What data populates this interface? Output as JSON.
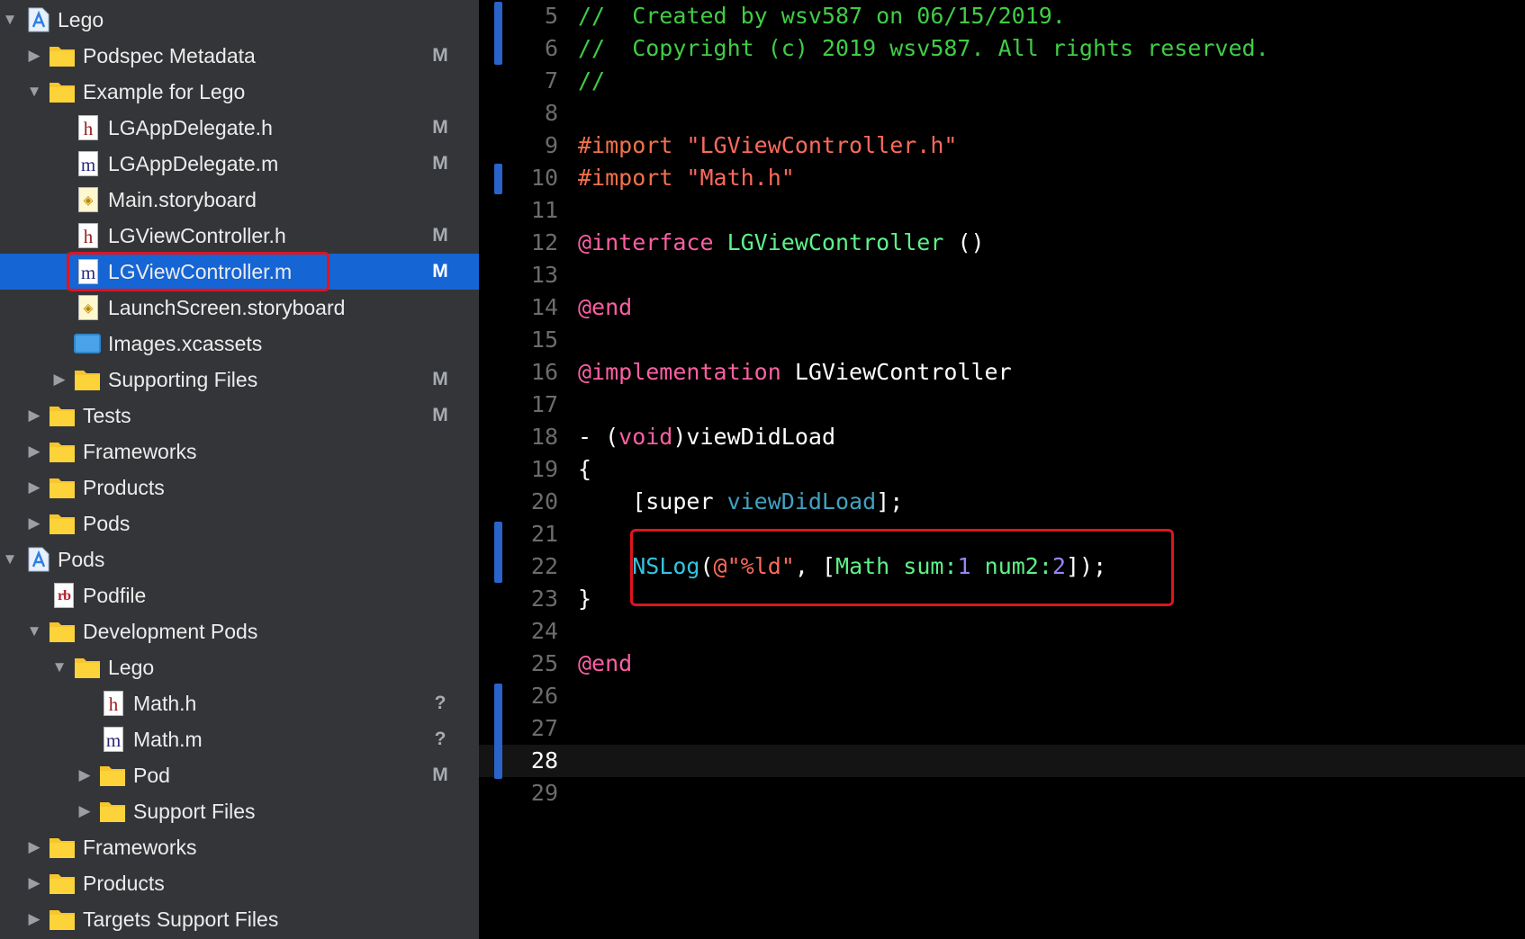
{
  "navigator": {
    "rows": [
      {
        "label": "Lego",
        "icon": "project-icon",
        "status": ""
      },
      {
        "label": "Podspec Metadata",
        "icon": "folder-icon",
        "status": "M"
      },
      {
        "label": "Example for Lego",
        "icon": "folder-icon",
        "status": ""
      },
      {
        "label": "LGAppDelegate.h",
        "icon": "header-file-icon",
        "status": "M"
      },
      {
        "label": "LGAppDelegate.m",
        "icon": "implementation-file-icon",
        "status": "M"
      },
      {
        "label": "Main.storyboard",
        "icon": "storyboard-file-icon",
        "status": ""
      },
      {
        "label": "LGViewController.h",
        "icon": "header-file-icon",
        "status": "M"
      },
      {
        "label": "LGViewController.m",
        "icon": "implementation-file-icon",
        "status": "M",
        "selected": true
      },
      {
        "label": "LaunchScreen.storyboard",
        "icon": "storyboard-file-icon",
        "status": ""
      },
      {
        "label": "Images.xcassets",
        "icon": "asset-catalog-icon",
        "status": ""
      },
      {
        "label": "Supporting Files",
        "icon": "folder-icon",
        "status": "M"
      },
      {
        "label": "Tests",
        "icon": "folder-icon",
        "status": "M"
      },
      {
        "label": "Frameworks",
        "icon": "folder-icon",
        "status": ""
      },
      {
        "label": "Products",
        "icon": "folder-icon",
        "status": ""
      },
      {
        "label": "Pods",
        "icon": "folder-icon",
        "status": ""
      },
      {
        "label": "Pods",
        "icon": "project-icon",
        "status": ""
      },
      {
        "label": "Podfile",
        "icon": "ruby-file-icon",
        "status": ""
      },
      {
        "label": "Development Pods",
        "icon": "folder-icon",
        "status": ""
      },
      {
        "label": "Lego",
        "icon": "folder-icon",
        "status": ""
      },
      {
        "label": "Math.h",
        "icon": "header-file-icon",
        "status": "?"
      },
      {
        "label": "Math.m",
        "icon": "implementation-file-icon",
        "status": "?"
      },
      {
        "label": "Pod",
        "icon": "folder-icon",
        "status": "M"
      },
      {
        "label": "Support Files",
        "icon": "folder-icon",
        "status": ""
      },
      {
        "label": "Frameworks",
        "icon": "folder-icon",
        "status": ""
      },
      {
        "label": "Products",
        "icon": "folder-icon",
        "status": ""
      },
      {
        "label": "Targets Support Files",
        "icon": "folder-icon",
        "status": ""
      }
    ]
  },
  "editor": {
    "current_line": 28,
    "lines": [
      {
        "num": "5",
        "tokens": [
          {
            "t": "//  Created by wsv587 on 06/15/2019.",
            "c": "comment"
          }
        ]
      },
      {
        "num": "6",
        "tokens": [
          {
            "t": "//  Copyright (c) 2019 wsv587. All rights reserved.",
            "c": "comment"
          }
        ]
      },
      {
        "num": "7",
        "tokens": [
          {
            "t": "//",
            "c": "comment"
          }
        ]
      },
      {
        "num": "8",
        "tokens": []
      },
      {
        "num": "9",
        "tokens": [
          {
            "t": "#import ",
            "c": "directive"
          },
          {
            "t": "\"LGViewController.h\"",
            "c": "string"
          }
        ]
      },
      {
        "num": "10",
        "tokens": [
          {
            "t": "#import ",
            "c": "directive"
          },
          {
            "t": "\"Math.h\"",
            "c": "string"
          }
        ]
      },
      {
        "num": "11",
        "tokens": []
      },
      {
        "num": "12",
        "tokens": [
          {
            "t": "@interface",
            "c": "keyword"
          },
          {
            "t": " ",
            "c": "plain"
          },
          {
            "t": "LGViewController",
            "c": "class"
          },
          {
            "t": " ()",
            "c": "plain"
          }
        ]
      },
      {
        "num": "13",
        "tokens": []
      },
      {
        "num": "14",
        "tokens": [
          {
            "t": "@end",
            "c": "keyword"
          }
        ]
      },
      {
        "num": "15",
        "tokens": []
      },
      {
        "num": "16",
        "tokens": [
          {
            "t": "@implementation",
            "c": "keyword"
          },
          {
            "t": " LGViewController",
            "c": "plain"
          }
        ]
      },
      {
        "num": "17",
        "tokens": []
      },
      {
        "num": "18",
        "tokens": [
          {
            "t": "- (",
            "c": "plain"
          },
          {
            "t": "void",
            "c": "keyword"
          },
          {
            "t": ")viewDidLoad",
            "c": "plain"
          }
        ]
      },
      {
        "num": "19",
        "tokens": [
          {
            "t": "{",
            "c": "plain"
          }
        ]
      },
      {
        "num": "20",
        "tokens": [
          {
            "t": "    [super ",
            "c": "plain"
          },
          {
            "t": "viewDidLoad",
            "c": "method"
          },
          {
            "t": "];",
            "c": "plain"
          }
        ]
      },
      {
        "num": "21",
        "tokens": []
      },
      {
        "num": "22",
        "tokens": [
          {
            "t": "    ",
            "c": "plain"
          },
          {
            "t": "NSLog",
            "c": "func"
          },
          {
            "t": "(",
            "c": "plain"
          },
          {
            "t": "@\"%ld\"",
            "c": "string"
          },
          {
            "t": ", [",
            "c": "plain"
          },
          {
            "t": "Math",
            "c": "class"
          },
          {
            "t": " ",
            "c": "plain"
          },
          {
            "t": "sum:",
            "c": "class"
          },
          {
            "t": "1",
            "c": "num"
          },
          {
            "t": " ",
            "c": "plain"
          },
          {
            "t": "num2:",
            "c": "class"
          },
          {
            "t": "2",
            "c": "num"
          },
          {
            "t": "]);",
            "c": "plain"
          }
        ]
      },
      {
        "num": "23",
        "tokens": [
          {
            "t": "}",
            "c": "plain"
          }
        ]
      },
      {
        "num": "24",
        "tokens": []
      },
      {
        "num": "25",
        "tokens": [
          {
            "t": "@end",
            "c": "keyword"
          }
        ]
      },
      {
        "num": "26",
        "tokens": []
      },
      {
        "num": "27",
        "tokens": []
      },
      {
        "num": "28",
        "tokens": []
      },
      {
        "num": "29",
        "tokens": []
      }
    ]
  }
}
